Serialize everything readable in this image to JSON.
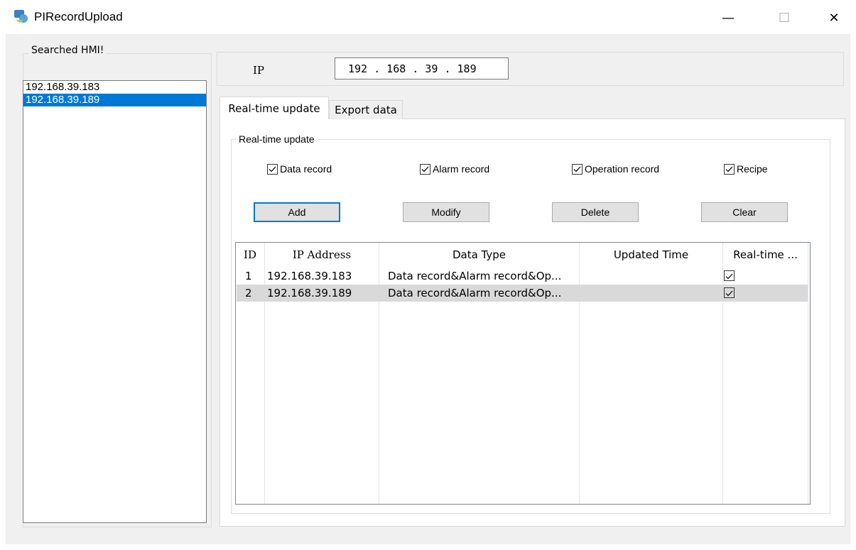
{
  "window": {
    "title": "PIRecordUpload",
    "minimize_icon": "minimize-icon",
    "maximize_icon": "maximize-icon",
    "close_icon": "close-icon"
  },
  "searched_hmi": {
    "label": "Searched HMI!",
    "items": [
      "192.168.39.183",
      "192.168.39.189"
    ],
    "selected_index": 1
  },
  "ip": {
    "label": "IP",
    "value": "192 . 168 . 39 . 189"
  },
  "tabs": [
    {
      "label": "Real-time update",
      "active": true
    },
    {
      "label": "Export data",
      "active": false
    }
  ],
  "realtime": {
    "group_label": "Real-time update",
    "checkboxes": [
      {
        "label": "Data record",
        "checked": true
      },
      {
        "label": "Alarm record",
        "checked": true
      },
      {
        "label": "Operation record",
        "checked": true
      },
      {
        "label": "Recipe",
        "checked": true
      }
    ],
    "buttons": {
      "add": "Add",
      "modify": "Modify",
      "delete": "Delete",
      "clear": "Clear"
    }
  },
  "table": {
    "headers": [
      "ID",
      "IP Address",
      "Data Type",
      "Updated Time",
      "Real-time ..."
    ],
    "rows": [
      {
        "id": "1",
        "ip": "192.168.39.183",
        "data_type": "Data record&Alarm record&Op...",
        "updated": "",
        "realtime": true
      },
      {
        "id": "2",
        "ip": "192.168.39.189",
        "data_type": "Data record&Alarm record&Op...",
        "updated": "",
        "realtime": true
      }
    ],
    "selected_row": 1
  },
  "colors": {
    "selection": "#0078d7",
    "client_bg": "#f0f0f0"
  }
}
